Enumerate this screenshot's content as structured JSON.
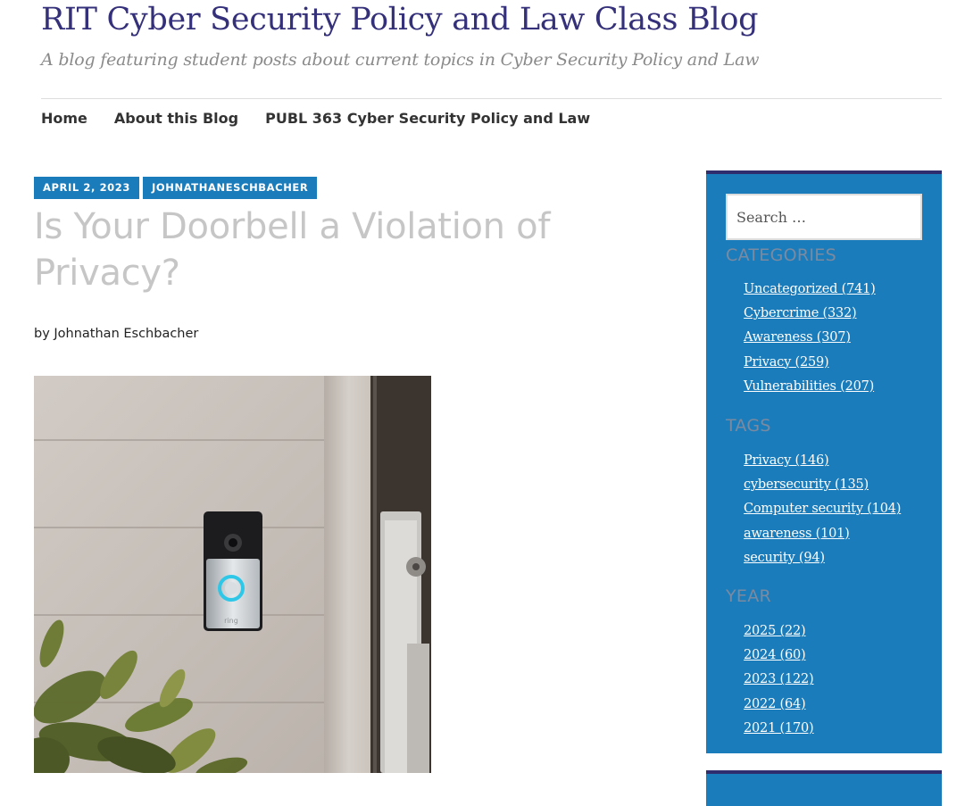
{
  "header": {
    "title": "RIT Cyber Security Policy and Law Class Blog",
    "tagline": "A blog featuring student posts about current topics in Cyber Security Policy and Law"
  },
  "nav": {
    "items": [
      {
        "label": "Home"
      },
      {
        "label": "About this Blog"
      },
      {
        "label": "PUBL 363 Cyber Security Policy and Law"
      }
    ]
  },
  "post": {
    "date": "APRIL 2, 2023",
    "author_tag": "JOHNATHANESCHBACHER",
    "title": "Is Your Doorbell a Violation of Privacy?",
    "byline": "by Johnathan Eschbacher",
    "image": {
      "icon": "ring-video-doorbell-photo",
      "brand_text": "ring"
    }
  },
  "sidebar": {
    "search": {
      "placeholder": "Search …"
    },
    "categories": {
      "title": "CATEGORIES",
      "items": [
        "Uncategorized (741)",
        "Cybercrime (332)",
        "Awareness (307)",
        "Privacy (259)",
        "Vulnerabilities (207)"
      ]
    },
    "tags": {
      "title": "TAGS",
      "items": [
        "Privacy (146)",
        "cybersecurity (135)",
        "Computer security (104)",
        "awareness (101)",
        "security (94)"
      ]
    },
    "year": {
      "title": "YEAR",
      "items": [
        "2025 (22)",
        "2024 (60)",
        "2023 (122)",
        "2022 (64)",
        "2021 (170)"
      ]
    }
  },
  "colors": {
    "site_title": "#35307a",
    "accent_blue": "#1b7cbb",
    "sidebar_border": "#2f2d6e",
    "post_title": "#c6c6c6"
  }
}
